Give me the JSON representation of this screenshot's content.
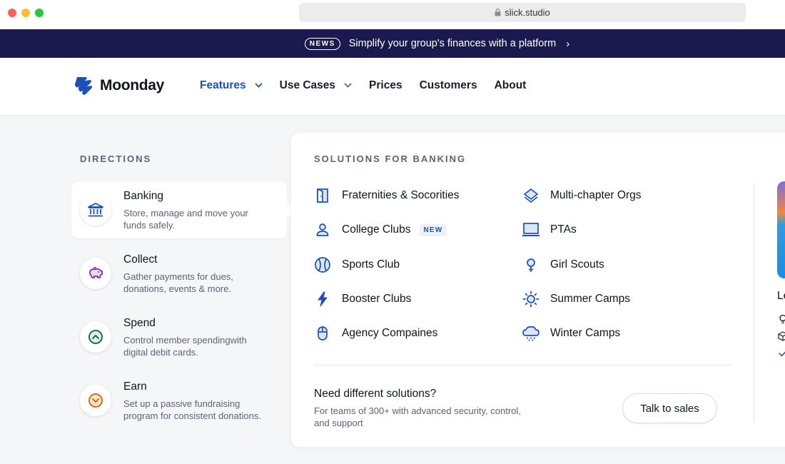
{
  "browser": {
    "url": "slick.studio"
  },
  "banner": {
    "badge": "NEWS",
    "text": "Simplify your group's finances with a platform",
    "chevron": "›"
  },
  "nav": {
    "brand": "Moonday",
    "links": [
      {
        "label": "Features",
        "has_dropdown": true,
        "active": true
      },
      {
        "label": "Use Cases",
        "has_dropdown": true,
        "active": false
      },
      {
        "label": "Prices",
        "has_dropdown": false
      },
      {
        "label": "Customers",
        "has_dropdown": false
      },
      {
        "label": "About",
        "has_dropdown": false
      }
    ]
  },
  "directions": {
    "title": "DIRECTIONS",
    "items": [
      {
        "label": "Banking",
        "desc": "Store, manage and  move your funds safely.",
        "icon": "bank-icon",
        "active": true
      },
      {
        "label": "Collect",
        "desc": "Gather payments for dues, donations, events & more.",
        "icon": "piggy-bank-icon"
      },
      {
        "label": "Spend",
        "desc": "Control member spendingwith digital debit cards.",
        "icon": "chevron-up-circle-icon"
      },
      {
        "label": "Earn",
        "desc": "Set up a passive fundraising program for consistent donations.",
        "icon": "chevron-down-circle-icon"
      }
    ]
  },
  "solutions": {
    "title": "SOLUTIONS FOR BANKING",
    "left": [
      {
        "label": "Fraternities & Socorities",
        "icon": "door-icon"
      },
      {
        "label": "College Clubs",
        "icon": "person-icon",
        "badge": "NEW"
      },
      {
        "label": "Sports Club",
        "icon": "ball-icon"
      },
      {
        "label": "Booster Clubs",
        "icon": "lightning-icon"
      },
      {
        "label": "Agency Compaines",
        "icon": "mouse-icon"
      }
    ],
    "right": [
      {
        "label": "Multi-chapter Orgs",
        "icon": "layers-icon"
      },
      {
        "label": "PTAs",
        "icon": "laptop-icon"
      },
      {
        "label": "Girl Scouts",
        "icon": "female-icon"
      },
      {
        "label": "Summer Camps",
        "icon": "sun-icon"
      },
      {
        "label": "Winter Camps",
        "icon": "cloud-snow-icon"
      }
    ],
    "footer": {
      "title": "Need different solutions?",
      "desc": "For teams of 300+ with advanced security, control, and support",
      "button": "Talk to sales"
    },
    "peek_text": "Le"
  },
  "colors": {
    "brand_blue": "#1c4fb8",
    "banner_bg": "#1b1a4e"
  }
}
